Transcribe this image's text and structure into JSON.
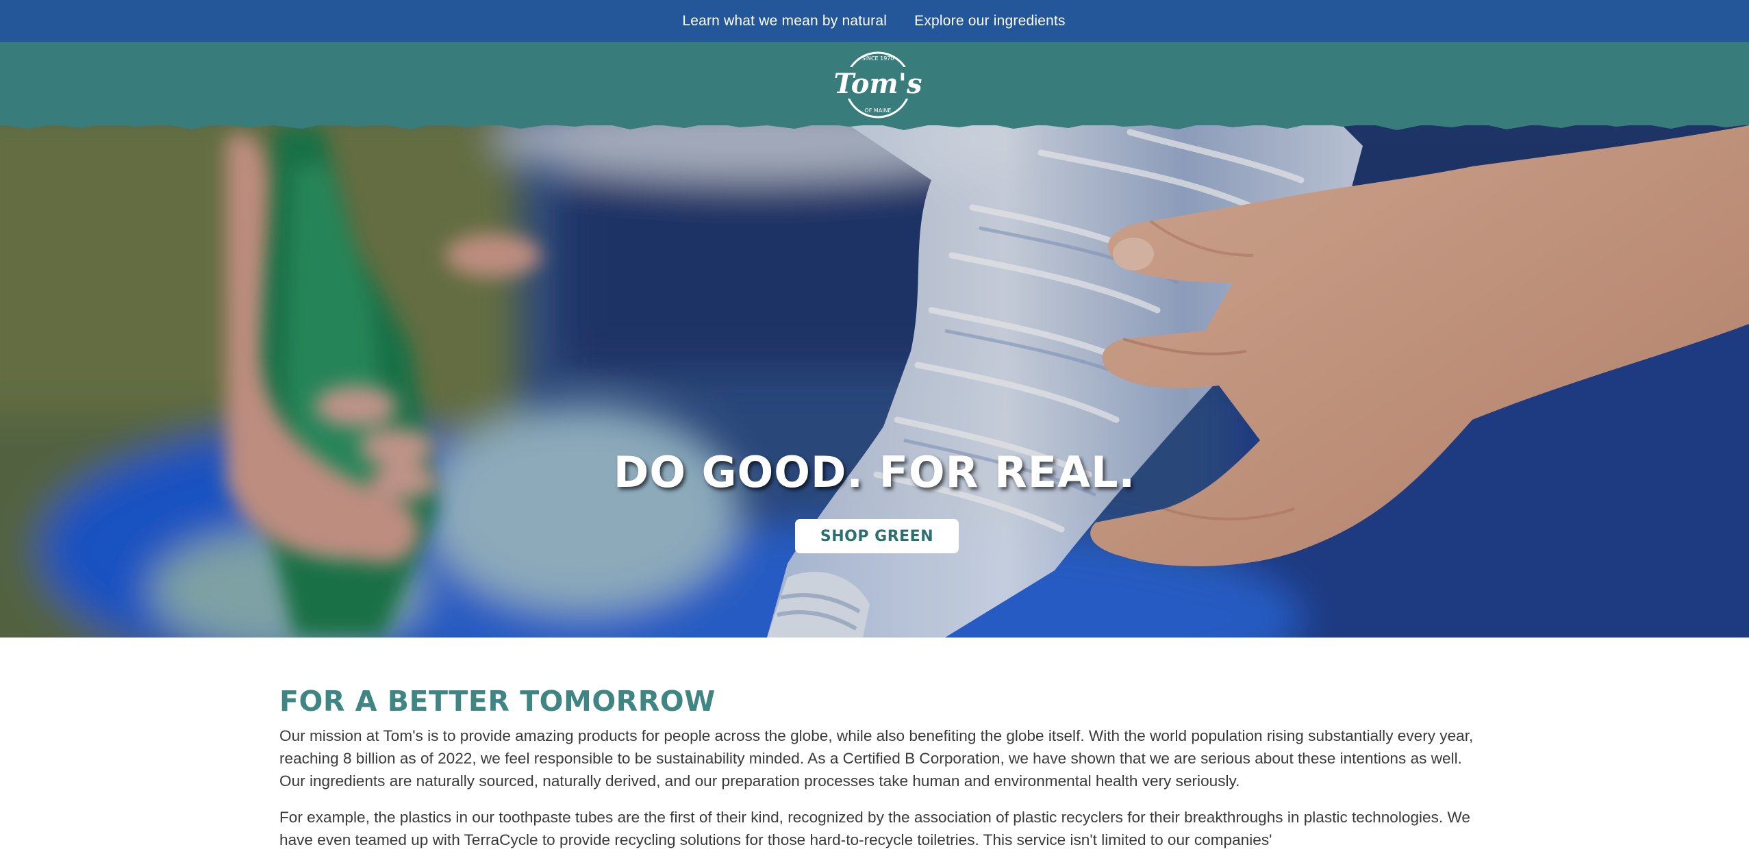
{
  "topbar": {
    "links": [
      {
        "label": "Learn what we mean by natural"
      },
      {
        "label": "Explore our ingredients"
      }
    ]
  },
  "header": {
    "logo": {
      "icon": "toms-of-maine-logo",
      "text": "Tom's",
      "arc_top": "SINCE 1970",
      "arc_bottom": "OF MAINE"
    }
  },
  "hero": {
    "title": "DO GOOD. FOR REAL.",
    "cta_label": "SHOP GREEN",
    "image_icon": "hands-recycling-bottles-photo"
  },
  "content": {
    "heading": "FOR A BETTER TOMORROW",
    "paragraphs": [
      "Our mission at Tom's is to provide amazing products for people across the globe, while also benefiting the globe itself. With the world population rising substantially every year, reaching 8 billion as of 2022, we feel responsible to be sustainability minded. As a Certified B Corporation, we have shown that we are serious about these intentions as well. Our ingredients are naturally sourced, naturally derived, and our preparation processes take human and environmental health very seriously.",
      "For example, the plastics in our toothpaste tubes are the first of their kind, recognized by the association of plastic recyclers for their breakthroughs in plastic technologies. We have even teamed up with TerraCycle to provide recycling solutions for those hard-to-recycle toiletries. This service isn't limited to our companies'"
    ]
  },
  "colors": {
    "topbar": "#235799",
    "header": "#387c7c",
    "heading": "#3f8584",
    "cta_text": "#2d6e72"
  }
}
